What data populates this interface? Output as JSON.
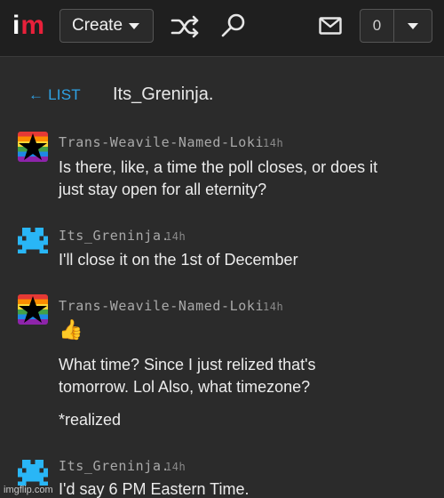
{
  "nav": {
    "logo_i": "i",
    "logo_m": "m",
    "create_label": "Create",
    "notification_count": "0"
  },
  "thread": {
    "back_label": "LIST",
    "title": "Its_Greninja."
  },
  "messages": [
    {
      "user": "Trans-Weavile-Named-Loki",
      "time": "14h",
      "lines": [
        "Is there, like, a time the poll closes, or does it",
        "just stay open for all eternity?"
      ]
    },
    {
      "user": "Its_Greninja.",
      "time": "14h",
      "lines": [
        "I'll close it on the 1st of December"
      ]
    },
    {
      "user": "Trans-Weavile-Named-Loki",
      "time": "14h",
      "emoji": "👍",
      "lines": [
        "What time? Since I just relized that's",
        "tomorrow. Lol Also, what timezone?"
      ],
      "followup": "*realized"
    },
    {
      "user": "Its_Greninja.",
      "time": "14h",
      "lines": [
        "I'd say 6 PM Eastern Time."
      ]
    }
  ],
  "watermark": "imgflip.com",
  "icons": {
    "create_caret": "caret-down-icon",
    "shuffle": "shuffle-icon",
    "search": "search-icon",
    "mail": "mail-icon",
    "notif_caret": "caret-down-icon",
    "back_arrow": "arrow-left-icon",
    "avatar_loki": "rainbow-star-avatar",
    "avatar_greninja": "pixel-creature-avatar"
  },
  "colors": {
    "background": "#2b2b2b",
    "topbar": "#1f1f1f",
    "logo_accent": "#e8203a",
    "link": "#2fa3e6",
    "pixel_avatar": "#29b6f6"
  }
}
